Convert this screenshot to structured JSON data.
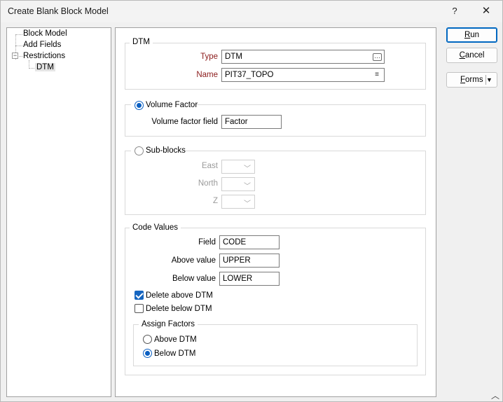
{
  "window": {
    "title": "Create Blank Block Model",
    "help_label": "?",
    "close_label": "✕"
  },
  "tree": {
    "items": [
      {
        "label": "Block Model"
      },
      {
        "label": "Add Fields"
      },
      {
        "label": "Restrictions",
        "expander": "−"
      },
      {
        "label": "DTM",
        "selected": true
      }
    ]
  },
  "dtm": {
    "group_title": "DTM",
    "type_label": "Type",
    "type_value": "DTM",
    "name_label": "Name",
    "name_value": "PIT37_TOPO",
    "type_icon": "ellipsis-icon",
    "name_icon": "list-icon"
  },
  "volume_factor": {
    "radio_label": "Volume Factor",
    "selected": true,
    "field_label": "Volume factor field",
    "field_value": "Factor"
  },
  "sub_blocks": {
    "radio_label": "Sub-blocks",
    "selected": false,
    "east_label": "East",
    "north_label": "North",
    "z_label": "Z",
    "east_value": "",
    "north_value": "",
    "z_value": ""
  },
  "code_values": {
    "group_title": "Code Values",
    "field_label": "Field",
    "field_value": "CODE",
    "above_label": "Above value",
    "above_value": "UPPER",
    "below_label": "Below value",
    "below_value": "LOWER",
    "delete_above_label": "Delete above DTM",
    "delete_above_checked": true,
    "delete_below_label": "Delete below DTM",
    "delete_below_checked": false,
    "assign": {
      "group_title": "Assign Factors",
      "above_label": "Above DTM",
      "below_label": "Below DTM",
      "selected": "Below DTM"
    }
  },
  "buttons": {
    "run": {
      "mnemonic": "R",
      "rest": "un"
    },
    "cancel": {
      "mnemonic": "C",
      "rest": "ancel"
    },
    "forms": {
      "mnemonic": "F",
      "rest": "orms"
    }
  },
  "colors": {
    "accent": "#0067c0",
    "required_label": "#8b1a1a",
    "disabled_text": "#9a9a9a"
  }
}
